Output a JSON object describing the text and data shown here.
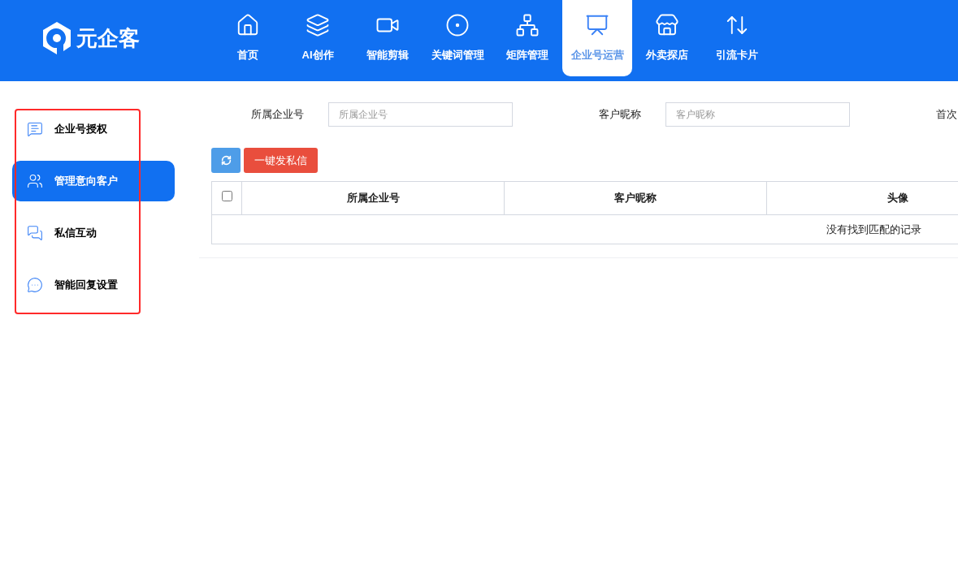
{
  "logo": {
    "text": "元企客"
  },
  "nav": [
    {
      "label": "首页",
      "selected": false
    },
    {
      "label": "AI创作",
      "selected": false
    },
    {
      "label": "智能剪辑",
      "selected": false
    },
    {
      "label": "关键词管理",
      "selected": false
    },
    {
      "label": "矩阵管理",
      "selected": false
    },
    {
      "label": "企业号运营",
      "selected": true
    },
    {
      "label": "外卖探店",
      "selected": false
    },
    {
      "label": "引流卡片",
      "selected": false
    }
  ],
  "sidebar": {
    "highlighted": true,
    "items": [
      {
        "label": "企业号授权",
        "selected": false
      },
      {
        "label": "管理意向客户",
        "selected": true
      },
      {
        "label": "私信互动",
        "selected": false
      },
      {
        "label": "智能回复设置",
        "selected": false
      }
    ]
  },
  "filters": [
    {
      "label": "所属企业号",
      "placeholder": "所属企业号"
    },
    {
      "label": "客户昵称",
      "placeholder": "客户昵称"
    },
    {
      "label": "首次"
    }
  ],
  "toolbar": {
    "send_button": "一键发私信"
  },
  "table": {
    "select_all": {
      "checked": false
    },
    "columns": [
      "所属企业号",
      "客户昵称",
      "头像"
    ],
    "empty_message": "没有找到匹配的记录"
  }
}
